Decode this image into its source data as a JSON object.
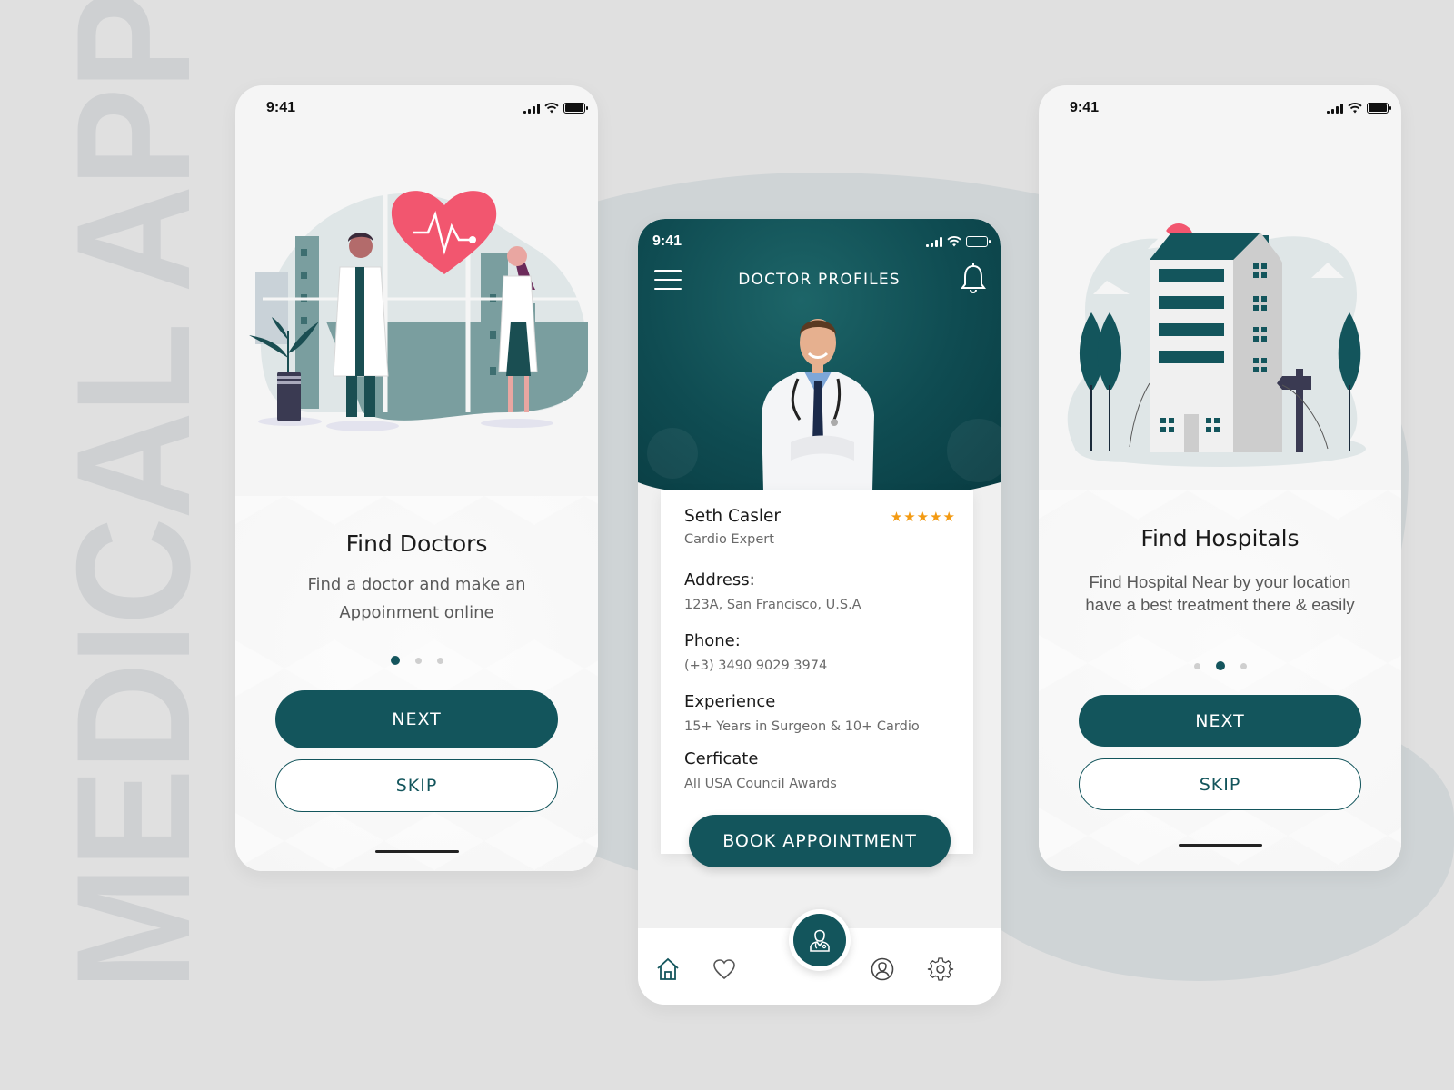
{
  "showcase_title": "MEDICAL APP",
  "colors": {
    "brand": "#13555c",
    "accent_heart": "#f2566f",
    "star": "#f39a12",
    "background": "#e0e0e0"
  },
  "status_bar": {
    "time": "9:41",
    "icons": [
      "signal-icon",
      "wifi-icon",
      "battery-icon"
    ]
  },
  "screen_find_doctors": {
    "illustration": "doctors-with-heart-illustration",
    "title": "Find Doctors",
    "description_line1": "Find a doctor and make an",
    "description_line2": "Appoinment online",
    "page_indicator": {
      "total": 3,
      "active": 1
    },
    "next_label": "NEXT",
    "skip_label": "SKIP"
  },
  "screen_doctor_profile": {
    "header_title": "DOCTOR PROFILES",
    "menu_icon": "hamburger-icon",
    "notification_icon": "bell-icon",
    "doctor": {
      "name": "Seth Casler",
      "specialty": "Cardio Expert",
      "rating": 5,
      "rating_max": 5,
      "fields": [
        {
          "label": "Address:",
          "value": "123A, San Francisco, U.S.A"
        },
        {
          "label": "Phone:",
          "value": "(+3) 3490 9029 3974"
        },
        {
          "label": "Experience",
          "value": "15+ Years in Surgeon & 10+ Cardio"
        },
        {
          "label": "Cerficate",
          "value": "All USA Council Awards"
        }
      ]
    },
    "book_label": "BOOK APPOINTMENT",
    "tabbar": {
      "items": [
        {
          "icon": "home-icon",
          "active": true
        },
        {
          "icon": "heart-icon",
          "active": false
        },
        {
          "icon": "doctor-icon",
          "active": false,
          "center": true
        },
        {
          "icon": "user-icon",
          "active": false
        },
        {
          "icon": "gear-icon",
          "active": false
        }
      ]
    }
  },
  "screen_find_hospitals": {
    "illustration": "hospital-building-illustration",
    "title": "Find Hospitals",
    "description_line1": "Find Hospital Near by your location",
    "description_line2": "have a best treatment there & easily",
    "page_indicator": {
      "total": 3,
      "active": 2
    },
    "next_label": "NEXT",
    "skip_label": "SKIP"
  }
}
